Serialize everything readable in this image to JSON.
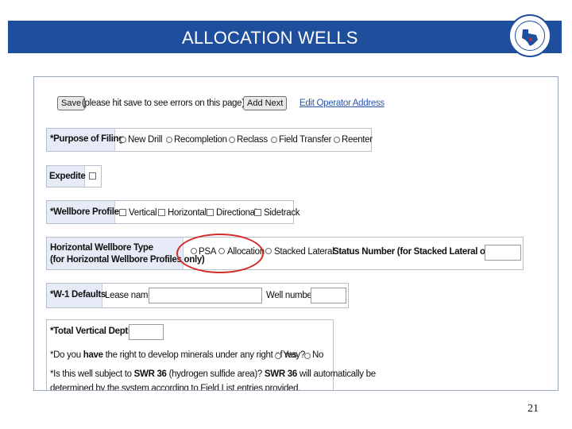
{
  "slide": {
    "title": "ALLOCATION WELLS",
    "page_number": "21",
    "seal_icon": "texas-railroad-commission-seal-icon",
    "banner_color": "#1f4f9c",
    "highlight_color": "#d42b2b"
  },
  "toolbar": {
    "save_label": "Save",
    "save_hint": "(please hit save to see errors on this page)",
    "add_next_label": "Add Next",
    "edit_operator_link": "Edit Operator Address"
  },
  "purpose": {
    "label": "*Purpose of Filing",
    "options": [
      "New Drill",
      "Recompletion",
      "Reclass",
      "Field Transfer",
      "Reenter"
    ]
  },
  "expedite": {
    "label": "Expedite"
  },
  "wellbore": {
    "label": "*Wellbore Profiles",
    "options": [
      "Vertical",
      "Horizontal",
      "Directional",
      "Sidetrack"
    ]
  },
  "horizontal": {
    "label_line1": "Horizontal Wellbore Type",
    "label_line2": "(for Horizontal Wellbore Profiles only)",
    "options": [
      "PSA",
      "Allocation",
      "Stacked Lateral"
    ],
    "status_label": "Status Number (for Stacked Lateral only)"
  },
  "w1": {
    "label": "*W-1 Defaults",
    "lease_label": "Lease name:",
    "well_label": "Well number:"
  },
  "tvd": {
    "label": "*Total Vertical Depth:",
    "q1_prefix": "*Do you ",
    "q1_bold": "have",
    "q1_rest": " the right to develop minerals under any right of way?",
    "q1_options": [
      "Yes",
      "No"
    ],
    "q2_prefix": "*Is this well subject to ",
    "q2_bold1": "SWR 36",
    "q2_mid": " (hydrogen sulfide area)? ",
    "q2_bold2": "SWR 36",
    "q2_rest": " will automatically be",
    "q3": "determined by the system according to Field List entries provided."
  }
}
